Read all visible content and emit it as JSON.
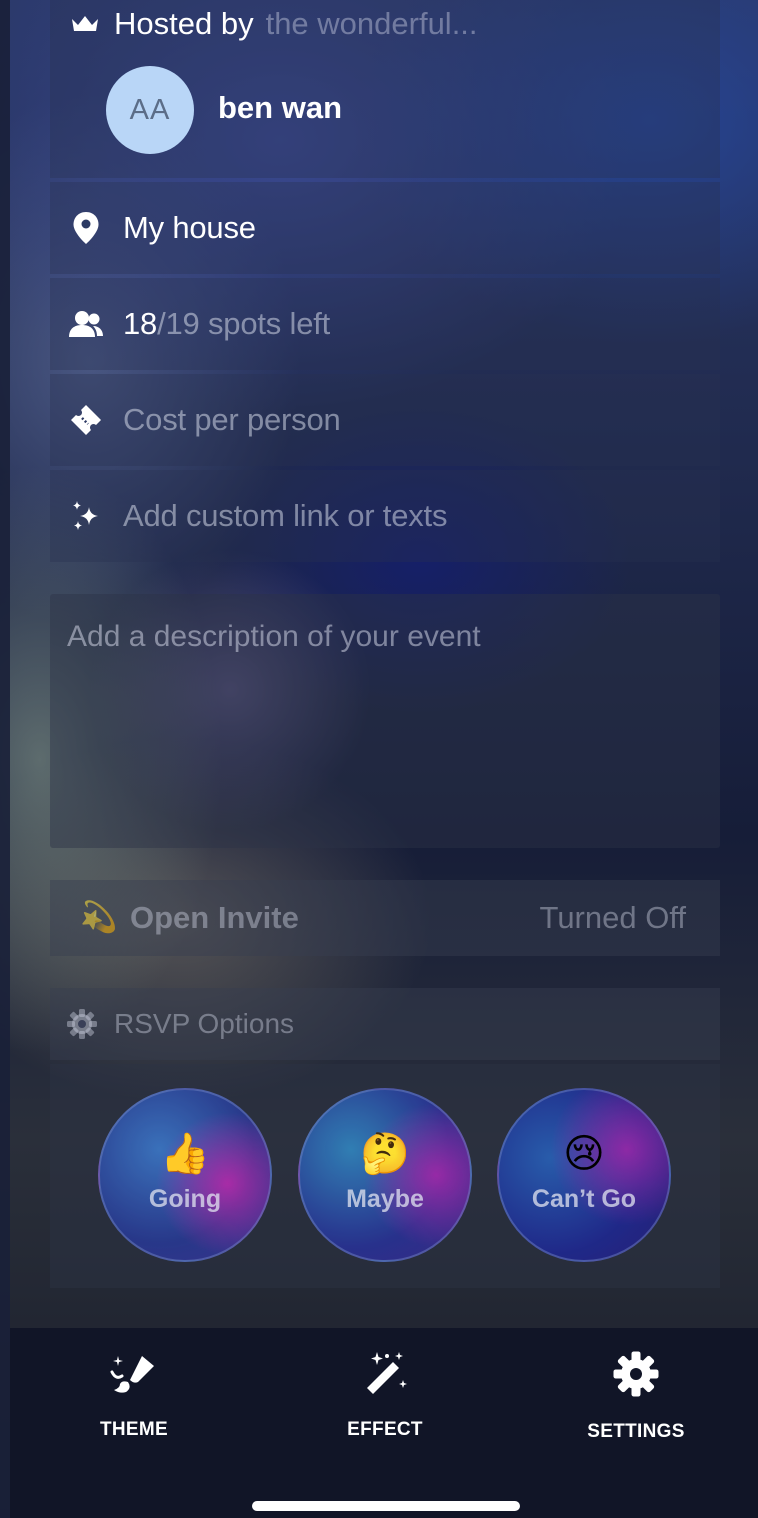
{
  "host": {
    "label": "Hosted by",
    "subtitle": "the wonderful...",
    "avatar_initials": "AA",
    "name": "ben wan",
    "icon": "crown-icon"
  },
  "details": {
    "location": {
      "icon": "map-pin-icon",
      "text": "My house"
    },
    "spots": {
      "icon": "users-icon",
      "taken": "18",
      "rest": "/19 spots left"
    },
    "cost": {
      "icon": "ticket-icon",
      "placeholder": "Cost per person"
    },
    "custom_link": {
      "icon": "sparkles-icon",
      "placeholder": "Add custom link or texts"
    }
  },
  "description": {
    "placeholder": "Add a description of your event"
  },
  "open_invite": {
    "emoji": "💫",
    "label": "Open Invite",
    "value": "Turned Off"
  },
  "rsvp": {
    "header": "RSVP Options",
    "icon": "gear-icon",
    "options": [
      {
        "emoji": "👍",
        "label": "Going"
      },
      {
        "emoji": "🤔",
        "label": "Maybe"
      },
      {
        "emoji": "😢",
        "label": "Can’t Go"
      }
    ]
  },
  "toolbar": {
    "items": [
      {
        "icon": "brush-icon",
        "label": "THEME"
      },
      {
        "icon": "magic-wand-icon",
        "label": "EFFECT"
      },
      {
        "icon": "gear-icon",
        "label": "SETTINGS"
      }
    ]
  }
}
